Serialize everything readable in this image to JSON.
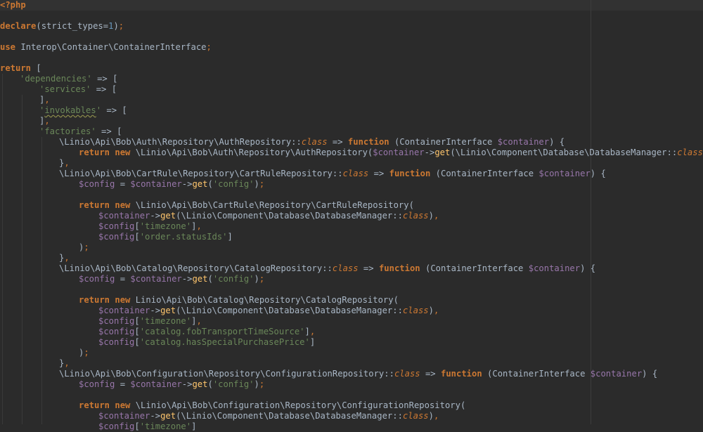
{
  "editor": {
    "colors": {
      "background": "#2b2b2b",
      "keyword": "#cc7832",
      "string": "#6a8759",
      "number": "#6897bb",
      "variable": "#9876aa",
      "function": "#ffc66d",
      "text": "#a9b7c6"
    },
    "lines": [
      {
        "row": 0,
        "indent": 0,
        "tokens": [
          [
            "kw",
            "<?php"
          ]
        ]
      },
      {
        "row": 2,
        "indent": 0,
        "tokens": [
          [
            "kw",
            "declare"
          ],
          [
            "txt",
            "(strict_types="
          ],
          [
            "num",
            "1"
          ],
          [
            "txt",
            ")"
          ],
          [
            "pun",
            ";"
          ]
        ]
      },
      {
        "row": 4,
        "indent": 0,
        "tokens": [
          [
            "kw",
            "use "
          ],
          [
            "txt",
            "Interop\\Container\\ContainerInterface"
          ],
          [
            "pun",
            ";"
          ]
        ]
      },
      {
        "row": 6,
        "indent": 0,
        "tokens": [
          [
            "kw",
            "return "
          ],
          [
            "txt",
            "["
          ]
        ]
      },
      {
        "row": 7,
        "indent": 1,
        "tokens": [
          [
            "str",
            "'dependencies'"
          ],
          [
            "txt",
            " => ["
          ]
        ]
      },
      {
        "row": 8,
        "indent": 2,
        "tokens": [
          [
            "str",
            "'services'"
          ],
          [
            "txt",
            " => ["
          ]
        ]
      },
      {
        "row": 9,
        "indent": 2,
        "tokens": [
          [
            "txt",
            "]"
          ],
          [
            "pun",
            ","
          ]
        ]
      },
      {
        "row": 10,
        "indent": 2,
        "tokens": [
          [
            "str",
            "'"
          ],
          [
            "str squig",
            "invokables"
          ],
          [
            "str",
            "'"
          ],
          [
            "txt",
            " => ["
          ]
        ]
      },
      {
        "row": 11,
        "indent": 2,
        "tokens": [
          [
            "txt",
            "]"
          ],
          [
            "pun",
            ","
          ]
        ]
      },
      {
        "row": 12,
        "indent": 2,
        "tokens": [
          [
            "str",
            "'factories'"
          ],
          [
            "txt",
            " => ["
          ]
        ]
      },
      {
        "row": 13,
        "indent": 3,
        "tokens": [
          [
            "txt",
            "\\Linio\\Api\\Bob\\Auth\\Repository\\AuthRepository::"
          ],
          [
            "cls",
            "class"
          ],
          [
            "txt",
            " => "
          ],
          [
            "kw",
            "function "
          ],
          [
            "txt",
            "(ContainerInterface "
          ],
          [
            "var",
            "$container"
          ],
          [
            "txt",
            ") {"
          ]
        ]
      },
      {
        "row": 14,
        "indent": 4,
        "tokens": [
          [
            "kw",
            "return new "
          ],
          [
            "txt",
            "\\Linio\\Api\\Bob\\Auth\\Repository\\AuthRepository("
          ],
          [
            "var",
            "$container"
          ],
          [
            "txt",
            "->"
          ],
          [
            "fn",
            "get"
          ],
          [
            "txt",
            "(\\Linio\\Component\\Database\\DatabaseManager::"
          ],
          [
            "cls",
            "class"
          ],
          [
            "txt",
            "))"
          ],
          [
            "pun",
            ";"
          ]
        ]
      },
      {
        "row": 15,
        "indent": 3,
        "tokens": [
          [
            "txt",
            "}"
          ],
          [
            "pun",
            ","
          ]
        ]
      },
      {
        "row": 16,
        "indent": 3,
        "tokens": [
          [
            "txt",
            "\\Linio\\Api\\Bob\\CartRule\\Repository\\CartRuleRepository::"
          ],
          [
            "cls",
            "class"
          ],
          [
            "txt",
            " => "
          ],
          [
            "kw",
            "function "
          ],
          [
            "txt",
            "(ContainerInterface "
          ],
          [
            "var",
            "$container"
          ],
          [
            "txt",
            ") {"
          ]
        ]
      },
      {
        "row": 17,
        "indent": 4,
        "tokens": [
          [
            "var",
            "$config"
          ],
          [
            "txt",
            " = "
          ],
          [
            "var",
            "$container"
          ],
          [
            "txt",
            "->"
          ],
          [
            "fn",
            "get"
          ],
          [
            "txt",
            "("
          ],
          [
            "str",
            "'config'"
          ],
          [
            "txt",
            ")"
          ],
          [
            "pun",
            ";"
          ]
        ]
      },
      {
        "row": 19,
        "indent": 4,
        "tokens": [
          [
            "kw",
            "return new "
          ],
          [
            "txt",
            "\\Linio\\Api\\Bob\\CartRule\\Repository\\CartRuleRepository("
          ]
        ]
      },
      {
        "row": 20,
        "indent": 5,
        "tokens": [
          [
            "var",
            "$container"
          ],
          [
            "txt",
            "->"
          ],
          [
            "fn",
            "get"
          ],
          [
            "txt",
            "(\\Linio\\Component\\Database\\DatabaseManager::"
          ],
          [
            "cls",
            "class"
          ],
          [
            "txt",
            ")"
          ],
          [
            "pun",
            ","
          ]
        ]
      },
      {
        "row": 21,
        "indent": 5,
        "tokens": [
          [
            "var",
            "$config"
          ],
          [
            "txt",
            "["
          ],
          [
            "str",
            "'timezone'"
          ],
          [
            "txt",
            "]"
          ],
          [
            "pun",
            ","
          ]
        ]
      },
      {
        "row": 22,
        "indent": 5,
        "tokens": [
          [
            "var",
            "$config"
          ],
          [
            "txt",
            "["
          ],
          [
            "str",
            "'order.statusIds'"
          ],
          [
            "txt",
            "]"
          ]
        ]
      },
      {
        "row": 23,
        "indent": 4,
        "tokens": [
          [
            "txt",
            ")"
          ],
          [
            "pun",
            ";"
          ]
        ]
      },
      {
        "row": 24,
        "indent": 3,
        "tokens": [
          [
            "txt",
            "}"
          ],
          [
            "pun",
            ","
          ]
        ]
      },
      {
        "row": 25,
        "indent": 3,
        "tokens": [
          [
            "txt",
            "\\Linio\\Api\\Bob\\Catalog\\Repository\\CatalogRepository::"
          ],
          [
            "cls",
            "class"
          ],
          [
            "txt",
            " => "
          ],
          [
            "kw",
            "function "
          ],
          [
            "txt",
            "(ContainerInterface "
          ],
          [
            "var",
            "$container"
          ],
          [
            "txt",
            ") {"
          ]
        ]
      },
      {
        "row": 26,
        "indent": 4,
        "tokens": [
          [
            "var",
            "$config"
          ],
          [
            "txt",
            " = "
          ],
          [
            "var",
            "$container"
          ],
          [
            "txt",
            "->"
          ],
          [
            "fn",
            "get"
          ],
          [
            "txt",
            "("
          ],
          [
            "str",
            "'config'"
          ],
          [
            "txt",
            ")"
          ],
          [
            "pun",
            ";"
          ]
        ]
      },
      {
        "row": 28,
        "indent": 4,
        "tokens": [
          [
            "kw",
            "return new "
          ],
          [
            "txt",
            "Linio\\Api\\Bob\\Catalog\\Repository\\CatalogRepository("
          ]
        ]
      },
      {
        "row": 29,
        "indent": 5,
        "tokens": [
          [
            "var",
            "$container"
          ],
          [
            "txt",
            "->"
          ],
          [
            "fn",
            "get"
          ],
          [
            "txt",
            "(\\Linio\\Component\\Database\\DatabaseManager::"
          ],
          [
            "cls",
            "class"
          ],
          [
            "txt",
            ")"
          ],
          [
            "pun",
            ","
          ]
        ]
      },
      {
        "row": 30,
        "indent": 5,
        "tokens": [
          [
            "var",
            "$config"
          ],
          [
            "txt",
            "["
          ],
          [
            "str",
            "'timezone'"
          ],
          [
            "txt",
            "]"
          ],
          [
            "pun",
            ","
          ]
        ]
      },
      {
        "row": 31,
        "indent": 5,
        "tokens": [
          [
            "var",
            "$config"
          ],
          [
            "txt",
            "["
          ],
          [
            "str",
            "'catalog.fobTransportTimeSource'"
          ],
          [
            "txt",
            "]"
          ],
          [
            "pun",
            ","
          ]
        ]
      },
      {
        "row": 32,
        "indent": 5,
        "tokens": [
          [
            "var",
            "$config"
          ],
          [
            "txt",
            "["
          ],
          [
            "str",
            "'catalog.hasSpecialPurchasePrice'"
          ],
          [
            "txt",
            "]"
          ]
        ]
      },
      {
        "row": 33,
        "indent": 4,
        "tokens": [
          [
            "txt",
            ")"
          ],
          [
            "pun",
            ";"
          ]
        ]
      },
      {
        "row": 34,
        "indent": 3,
        "tokens": [
          [
            "txt",
            "}"
          ],
          [
            "pun",
            ","
          ]
        ]
      },
      {
        "row": 35,
        "indent": 3,
        "tokens": [
          [
            "txt",
            "\\Linio\\Api\\Bob\\Configuration\\Repository\\ConfigurationRepository::"
          ],
          [
            "cls",
            "class"
          ],
          [
            "txt",
            " => "
          ],
          [
            "kw",
            "function "
          ],
          [
            "txt",
            "(ContainerInterface "
          ],
          [
            "var",
            "$container"
          ],
          [
            "txt",
            ") {"
          ]
        ]
      },
      {
        "row": 36,
        "indent": 4,
        "tokens": [
          [
            "var",
            "$config"
          ],
          [
            "txt",
            " = "
          ],
          [
            "var",
            "$container"
          ],
          [
            "txt",
            "->"
          ],
          [
            "fn",
            "get"
          ],
          [
            "txt",
            "("
          ],
          [
            "str",
            "'config'"
          ],
          [
            "txt",
            ")"
          ],
          [
            "pun",
            ";"
          ]
        ]
      },
      {
        "row": 38,
        "indent": 4,
        "tokens": [
          [
            "kw",
            "return new "
          ],
          [
            "txt",
            "\\Linio\\Api\\Bob\\Configuration\\Repository\\ConfigurationRepository("
          ]
        ]
      },
      {
        "row": 39,
        "indent": 5,
        "tokens": [
          [
            "var",
            "$container"
          ],
          [
            "txt",
            "->"
          ],
          [
            "fn",
            "get"
          ],
          [
            "txt",
            "(\\Linio\\Component\\Database\\DatabaseManager::"
          ],
          [
            "cls",
            "class"
          ],
          [
            "txt",
            ")"
          ],
          [
            "pun",
            ","
          ]
        ]
      },
      {
        "row": 40,
        "indent": 5,
        "tokens": [
          [
            "var",
            "$config"
          ],
          [
            "txt",
            "["
          ],
          [
            "str",
            "'timezone'"
          ],
          [
            "txt",
            "]"
          ]
        ]
      }
    ]
  }
}
